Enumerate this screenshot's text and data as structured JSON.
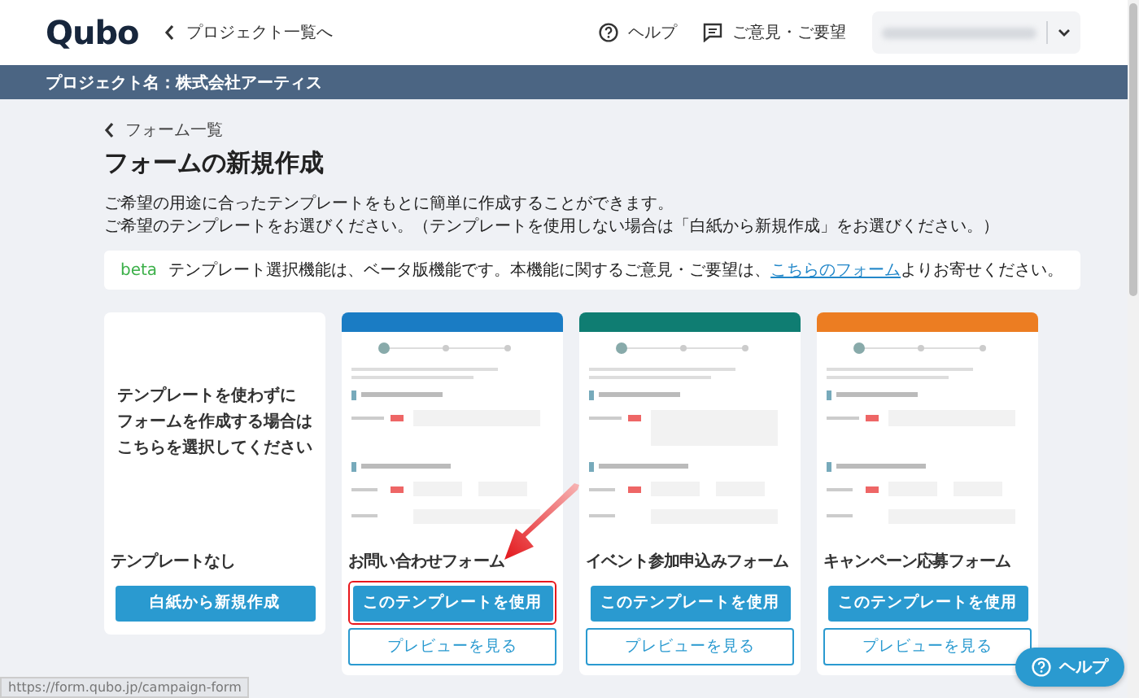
{
  "header": {
    "logo": "Qubo",
    "back_link": "プロジェクト一覧へ",
    "help": "ヘルプ",
    "feedback": "ご意見・ご要望"
  },
  "project_bar": "プロジェクト名：株式会社アーティス",
  "breadcrumb": "フォーム一覧",
  "title": "フォームの新規作成",
  "description": [
    "ご希望の用途に合ったテンプレートをもとに簡単に作成することができます。",
    "ご希望のテンプレートをお選びください。（テンプレートを使用しない場合は「白紙から新規作成」をお選びください。）"
  ],
  "notice": {
    "badge": "beta",
    "text": "テンプレート選択機能は、ベータ版機能です。本機能に関するご意見・ご要望は、",
    "link": "こちらのフォーム",
    "text_after": "よりお寄せください。"
  },
  "cards": [
    {
      "kind": "blank",
      "prompt": [
        "テンプレートを使わずに",
        "フォームを作成する場合は",
        "こちらを選択してください"
      ],
      "name": "テンプレートなし",
      "primary_button": "白紙から新規作成",
      "highlighted": false
    },
    {
      "kind": "template",
      "color": "#1a7cc4",
      "name": "お問い合わせフォーム",
      "primary_button": "このテンプレートを使用",
      "preview_button": "プレビューを見る",
      "highlighted": true
    },
    {
      "kind": "template",
      "color": "#0f7d72",
      "name": "イベント参加申込みフォーム",
      "primary_button": "このテンプレートを使用",
      "preview_button": "プレビューを見る",
      "highlighted": false
    },
    {
      "kind": "template",
      "color": "#ec7d22",
      "name": "キャンペーン応募フォーム",
      "primary_button": "このテンプレートを使用",
      "preview_button": "プレビューを見る",
      "highlighted": false
    }
  ],
  "help_button": "ヘルプ",
  "status_url": "https://form.qubo.jp/campaign-form"
}
